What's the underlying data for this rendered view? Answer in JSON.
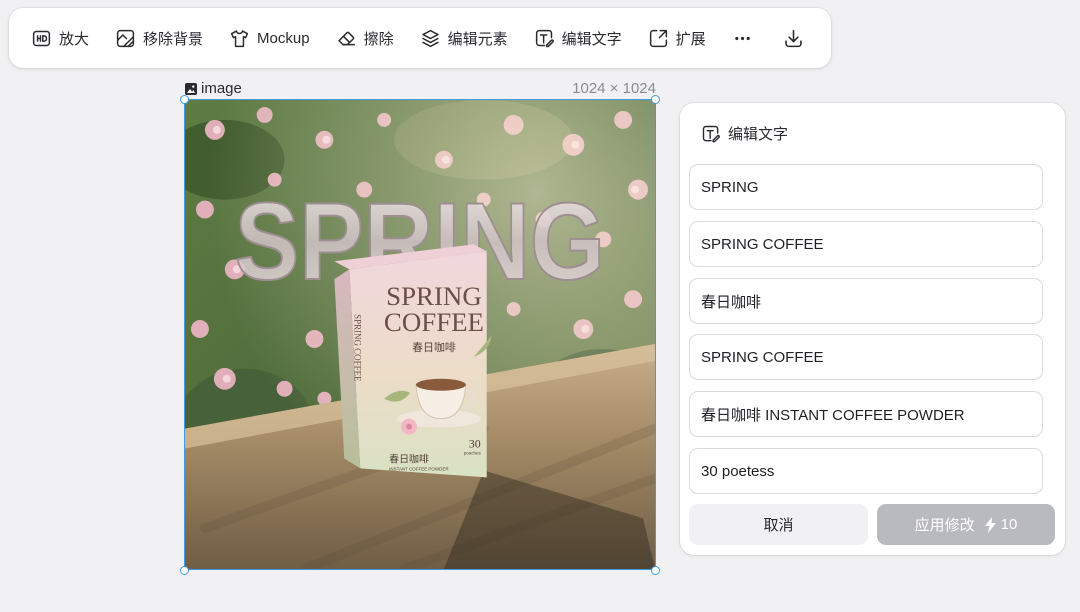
{
  "toolbar": {
    "items": [
      {
        "label": "放大",
        "icon": "hd-icon"
      },
      {
        "label": "移除背景",
        "icon": "remove-background-icon"
      },
      {
        "label": "Mockup",
        "icon": "tshirt-icon"
      },
      {
        "label": "擦除",
        "icon": "eraser-icon"
      },
      {
        "label": "编辑元素",
        "icon": "layers-icon"
      },
      {
        "label": "编辑文字",
        "icon": "edit-text-icon"
      },
      {
        "label": "扩展",
        "icon": "expand-icon"
      }
    ],
    "more_icon": "more-icon",
    "download_icon": "download-icon"
  },
  "canvas": {
    "image_label": "image",
    "image_size": "1024 × 1024",
    "artwork": {
      "headline": "SPRING",
      "box_line1": "SPRING",
      "box_line2": "COFFEE",
      "box_cn": "春日咖啡",
      "box_side": "SPRING COFFEE",
      "box_bottom_cn": "春日咖啡",
      "box_bottom_en": "INSTANT COFFEE POWDER",
      "box_count": "30",
      "box_count_unit": "pouches"
    }
  },
  "edit_panel": {
    "title": "编辑文字",
    "fields": [
      "SPRING",
      "SPRING COFFEE",
      "春日咖啡",
      "SPRING COFFEE",
      "春日咖啡 INSTANT COFFEE POWDER",
      "30 poetess"
    ],
    "cancel_label": "取消",
    "apply_label": "应用修改",
    "apply_cost": "10"
  },
  "colors": {
    "accent": "#3f9be8",
    "apply_disabled": "#b9b9c0",
    "background": "#f1f1f3"
  }
}
